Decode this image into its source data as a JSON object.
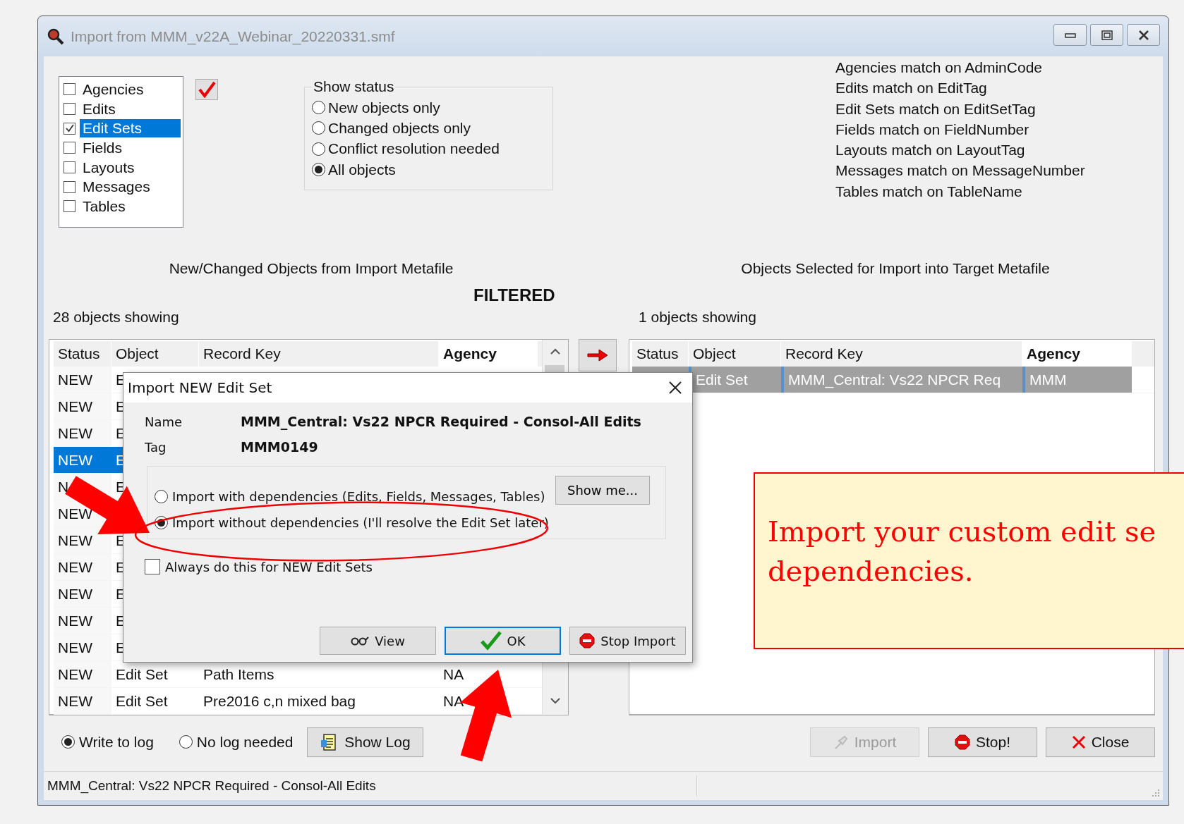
{
  "window": {
    "title": "Import from MMM_v22A_Webinar_20220331.smf"
  },
  "object_types": [
    {
      "label": "Agencies",
      "checked": false,
      "selected": false
    },
    {
      "label": "Edits",
      "checked": false,
      "selected": false
    },
    {
      "label": "Edit Sets",
      "checked": true,
      "selected": true
    },
    {
      "label": "Fields",
      "checked": false,
      "selected": false
    },
    {
      "label": "Layouts",
      "checked": false,
      "selected": false
    },
    {
      "label": "Messages",
      "checked": false,
      "selected": false
    },
    {
      "label": "Tables",
      "checked": false,
      "selected": false
    }
  ],
  "show_status": {
    "title": "Show status",
    "options": [
      {
        "label": "New objects only",
        "selected": false
      },
      {
        "label": "Changed objects only",
        "selected": false
      },
      {
        "label": "Conflict resolution needed",
        "selected": false
      },
      {
        "label": "All objects",
        "selected": true
      }
    ]
  },
  "match_rules": [
    "Agencies match on AdminCode",
    "Edits match on EditTag",
    "Edit Sets match on EditSetTag",
    "Fields match on FieldNumber",
    "Layouts match on LayoutTag",
    "Messages match on MessageNumber",
    "Tables match on TableName"
  ],
  "left_panel": {
    "heading": "New/Changed Objects from Import Metafile",
    "count": "28 objects showing",
    "columns": [
      "Status",
      "Object",
      "Record Key",
      "Agency"
    ],
    "rows": [
      {
        "status": "NEW",
        "object": "E",
        "selected": false
      },
      {
        "status": "NEW",
        "object": "E",
        "selected": false
      },
      {
        "status": "NEW",
        "object": "E",
        "selected": false
      },
      {
        "status": "NEW",
        "object": "E",
        "selected": true
      },
      {
        "status": "N",
        "object": "E",
        "selected": false
      },
      {
        "status": "NEW",
        "selected": false
      },
      {
        "status": "NEW",
        "object": "E",
        "selected": false
      },
      {
        "status": "NEW",
        "object": "E",
        "selected": false
      },
      {
        "status": "NEW",
        "object": "E",
        "selected": false
      },
      {
        "status": "NEW",
        "object": "E",
        "selected": false
      },
      {
        "status": "NEW",
        "object": "E",
        "selected": false
      },
      {
        "status": "NEW",
        "object": "Edit Set",
        "record_key": "Path Items",
        "agency": "NA",
        "selected": false
      },
      {
        "status": "NEW",
        "object": "Edit Set",
        "record_key": "Pre2016 c,n mixed bag",
        "agency": "NA",
        "selected": false
      }
    ]
  },
  "filter_label": "FILTERED",
  "right_panel": {
    "heading": "Objects Selected for Import into Target Metafile",
    "count": "1 objects showing",
    "columns": [
      "Status",
      "Object",
      "Record Key",
      "Agency"
    ],
    "rows": [
      {
        "object": "Edit Set",
        "record_key": "MMM_Central: Vs22 NPCR Req",
        "agency": "MMM",
        "selected": true
      }
    ]
  },
  "dialog": {
    "title": "Import NEW Edit Set",
    "name_label": "Name",
    "name_value": "MMM_Central: Vs22 NPCR Required - Consol-All Edits",
    "tag_label": "Tag",
    "tag_value": "MMM0149",
    "options": [
      {
        "label": "Import with dependencies (Edits, Fields, Messages, Tables)",
        "selected": false
      },
      {
        "label": "Import without dependencies (I'll resolve the Edit Set later)",
        "selected": true
      }
    ],
    "show_me_button": "Show me...",
    "always_checkbox": {
      "label": "Always do this for NEW Edit Sets",
      "checked": false
    },
    "buttons": [
      {
        "label": "View",
        "kind": "view",
        "focused": false
      },
      {
        "label": "OK",
        "kind": "ok",
        "focused": true
      },
      {
        "label": "Stop Import",
        "kind": "stop",
        "focused": false
      }
    ]
  },
  "log_options": [
    {
      "label": "Write to log",
      "selected": true
    },
    {
      "label": "No log needed",
      "selected": false
    }
  ],
  "show_log_button": "Show Log",
  "action_buttons": [
    {
      "label": "Import",
      "kind": "import",
      "disabled": true
    },
    {
      "label": "Stop!",
      "kind": "stop",
      "disabled": false
    },
    {
      "label": "Close",
      "kind": "close",
      "disabled": false
    }
  ],
  "status_bar": "MMM_Central: Vs22 NPCR Required - Consol-All Edits",
  "callout": {
    "lines": [
      "Import your custom edit se",
      "dependencies."
    ]
  }
}
